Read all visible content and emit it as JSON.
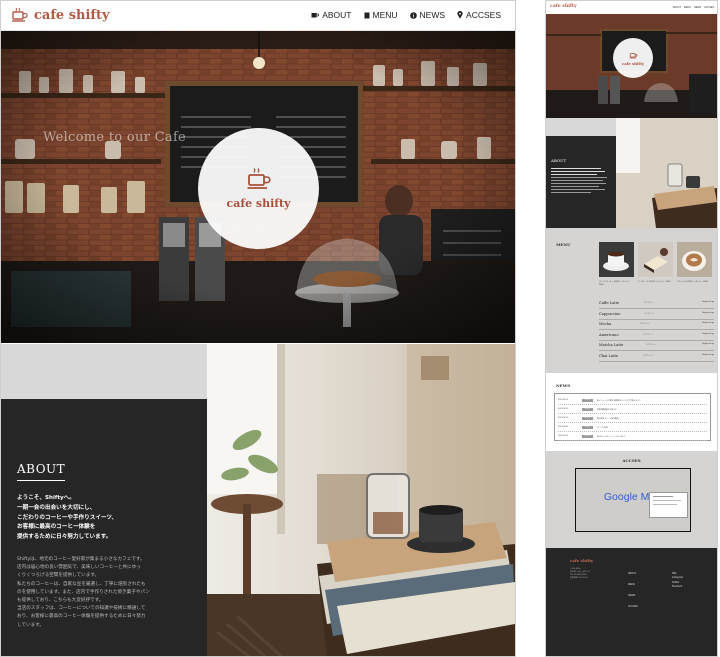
{
  "site": {
    "brand": "cafe shifty",
    "accent_color": "#b35a46",
    "dark_color": "#262626",
    "header_icon": "coffee-cup-icon"
  },
  "nav": [
    {
      "label": "ABOUT",
      "icon": "coffee-cup-icon"
    },
    {
      "label": "MENU",
      "icon": "book-icon"
    },
    {
      "label": "NEWS",
      "icon": "info-circle-icon"
    },
    {
      "label": "ACCSES",
      "icon": "map-pin-icon"
    }
  ],
  "hero": {
    "welcome": "Welcome to our Cafe",
    "circle_title": "cafe shifty"
  },
  "about": {
    "title": "ABOUT",
    "lead": "ようこそ、Shiftyへ。\n一期一会の出会いを大切にし、\nこだわりのコーヒーや手作りスイーツ、\nお客様に最高のコーヒー体験を\n提供するために日々努力しています。",
    "body": "Shiftyは、地元のコーヒー愛好家が集まる小さなカフェです。\n店内は居心地の良い雰囲気で、美味しいコーヒーと共にゆっ\nくりくつろげる空間を提供しています。\n私たちのコーヒーは、自家な豆を厳選し、丁寧に焙煎されたも\nのを使用しています。また、店内で手作りされた焼き菓子やパン\nも提供しており、こちらも大変好評です。\n当店のスタッフは、コーヒーについての知識や技術に精通して\nおり、お客様に最高のコーヒー体験を提供するために日々努力\nしています。"
  },
  "preview": {
    "nav": [
      "ABOUT",
      "MENU",
      "NEWS",
      "ACCSES"
    ],
    "about_title": "ABOUT",
    "menu": {
      "title": "MENU",
      "thumbs": [
        {
          "caption": "ブレンドコーヒー 400円 / レギュラー ¥400"
        },
        {
          "caption": "チーズケーキ 550円 / レギュラー ¥550"
        },
        {
          "caption": "カフェラテ 500円 / レギュラー ¥500"
        }
      ],
      "items": [
        {
          "name": "Caffe Latte",
          "desc": "エスプレッソ",
          "price": "Regular\nLarge"
        },
        {
          "name": "Cappuccino",
          "desc": "エスプレッソ",
          "price": "Regular\nLarge"
        },
        {
          "name": "Mocha",
          "desc": "エスプレッソ",
          "price": "Regular\nLarge"
        },
        {
          "name": "Americano",
          "desc": "エスプレッソ",
          "price": "Regular\nLarge"
        },
        {
          "name": "Matcha Latte",
          "desc": "エスプレッソ",
          "price": "Regular\nLarge"
        },
        {
          "name": "Chai Latte",
          "desc": "エスプレッソ",
          "price": "Regular\nLarge"
        }
      ]
    },
    "news": {
      "title": "NEWS",
      "items": [
        {
          "date": "2023.05.01",
          "tag": "お知らせ",
          "text": "新メニューのご案内 季節限定ドリンクが登場しました"
        },
        {
          "date": "2023.04.20",
          "tag": "お知らせ",
          "text": "営業時間変更のお知らせ"
        },
        {
          "date": "2023.04.10",
          "tag": "お知らせ",
          "text": "春の限定スイーツ販売開始"
        },
        {
          "date": "2023.04.01",
          "tag": "お知らせ",
          "text": "オープン記念"
        },
        {
          "date": "2023.03.25",
          "tag": "お知らせ",
          "text": "Webサイトをリニューアルしました"
        }
      ]
    },
    "access": {
      "title": "ACCSES",
      "map_label": "Google Map"
    },
    "footer": {
      "brand": "cafe shifty",
      "address": "〒000-0000\n東京都○○区○○町1-2-3\nTEL 00-0000-0000\n営業時間 9:00-20:00",
      "nav": [
        "ABOUT",
        "MENU",
        "NEWS",
        "ACCSES"
      ],
      "sns": "SNS\nInstagram\nTwitter\nFacebook"
    }
  }
}
